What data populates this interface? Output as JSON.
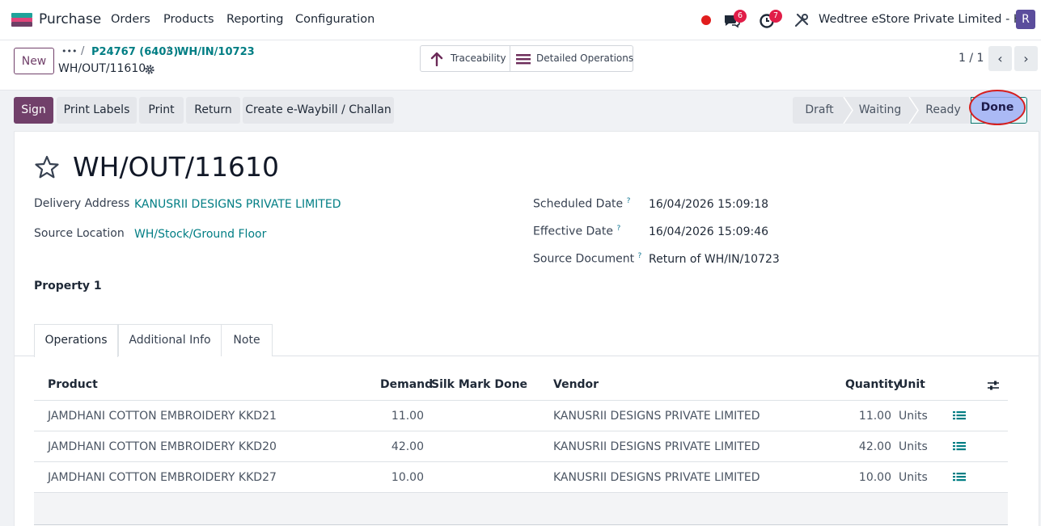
{
  "navbar": {
    "app_name": "Purchase",
    "menu": [
      "Orders",
      "Products",
      "Reporting",
      "Configuration"
    ],
    "messages_count": "6",
    "activities_count": "7",
    "company": "Wedtree eStore Private Limited - HO",
    "avatar_initial": "R"
  },
  "control": {
    "new_label": "New",
    "breadcrumb_ellipsis": "•••",
    "breadcrumbs": [
      "P24767 (6403)",
      "WH/IN/10723"
    ],
    "separator": "/",
    "record_name": "WH/OUT/11610",
    "smart_buttons": {
      "traceability": "Traceability",
      "detailed_operations": "Detailed Operations"
    },
    "pager": "1 / 1",
    "prev": "‹",
    "next": "›"
  },
  "actions": {
    "buttons": [
      "Sign",
      "Print Labels",
      "Print",
      "Return",
      "Create e-Waybill / Challan"
    ],
    "stages": [
      "Draft",
      "Waiting",
      "Ready",
      "Done"
    ],
    "current_stage": "Done"
  },
  "form": {
    "title": "WH/OUT/11610",
    "left_fields": [
      {
        "label": "Delivery Address",
        "value": "KANUSRII DESIGNS PRIVATE LIMITED"
      },
      {
        "label": "Source Location",
        "value": "WH/Stock/Ground Floor"
      }
    ],
    "right_fields": [
      {
        "label": "Scheduled Date",
        "help": "?",
        "value": "16/04/2026 15:09:18"
      },
      {
        "label": "Effective Date",
        "help": "?",
        "value": "16/04/2026 15:09:46"
      },
      {
        "label": "Source Document",
        "help": "?",
        "value": "Return of WH/IN/10723"
      }
    ],
    "property": "Property 1",
    "tabs": [
      "Operations",
      "Additional Info",
      "Note"
    ]
  },
  "table": {
    "headers": {
      "product": "Product",
      "demand": "Demand",
      "silk_mark_done": "Silk Mark Done",
      "vendor": "Vendor",
      "quantity": "Quantity",
      "unit": "Unit"
    },
    "rows": [
      {
        "product": "JAMDHANI COTTON EMBROIDERY KKD21",
        "demand": "11.00",
        "vendor": "KANUSRII DESIGNS PRIVATE LIMITED",
        "quantity": "11.00",
        "unit": "Units"
      },
      {
        "product": "JAMDHANI COTTON EMBROIDERY KKD20",
        "demand": "42.00",
        "vendor": "KANUSRII DESIGNS PRIVATE LIMITED",
        "quantity": "42.00",
        "unit": "Units"
      },
      {
        "product": "JAMDHANI COTTON EMBROIDERY KKD27",
        "demand": "10.00",
        "vendor": "KANUSRII DESIGNS PRIVATE LIMITED",
        "quantity": "10.00",
        "unit": "Units"
      }
    ]
  },
  "colors": {
    "primary": "#71406a",
    "link": "#017e84",
    "highlight_ring": "#d61f1f"
  }
}
